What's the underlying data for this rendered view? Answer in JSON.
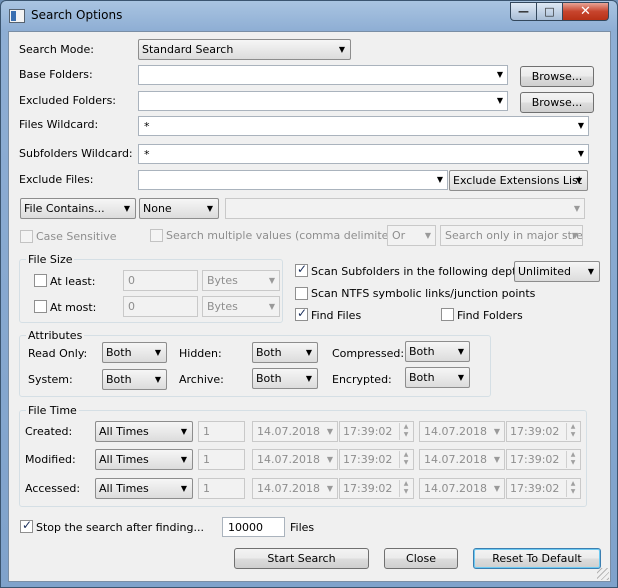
{
  "window": {
    "title": "Search Options",
    "minimize_glyph": "—",
    "maximize_glyph": "□",
    "close_glyph": "✕"
  },
  "search_mode": {
    "label": "Search Mode:",
    "value": "Standard Search"
  },
  "base_folders": {
    "label": "Base Folders:",
    "value": "",
    "browse_label": "Browse..."
  },
  "excluded_folders": {
    "label": "Excluded Folders:",
    "value": "",
    "browse_label": "Browse..."
  },
  "files_wildcard": {
    "label": "Files Wildcard:",
    "value": "*"
  },
  "subfolders_wildcard": {
    "label": "Subfolders Wildcard:",
    "value": "*"
  },
  "exclude_files": {
    "label": "Exclude Files:",
    "value": "",
    "mode": "Exclude Extensions List"
  },
  "content": {
    "mode": "File Contains...",
    "type": "None",
    "value": "",
    "case_sensitive": {
      "label": "Case Sensitive",
      "checked": false,
      "enabled": false
    },
    "multiple_values": {
      "label": "Search multiple values (comma delimited)",
      "checked": false,
      "enabled": false
    },
    "logic": "Or",
    "stream": "Search only in major stre"
  },
  "file_size": {
    "legend": "File Size",
    "at_least": {
      "label": "At least:",
      "checked": false,
      "value": "0",
      "unit": "Bytes"
    },
    "at_most": {
      "label": "At most:",
      "checked": false,
      "value": "0",
      "unit": "Bytes"
    }
  },
  "options": {
    "scan_subfolders": {
      "label": "Scan Subfolders in the following depth:",
      "checked": true,
      "depth": "Unlimited"
    },
    "scan_ntfs": {
      "label": "Scan NTFS symbolic links/junction points",
      "checked": false
    },
    "find_files": {
      "label": "Find Files",
      "checked": true
    },
    "find_folders": {
      "label": "Find Folders",
      "checked": false
    }
  },
  "attributes": {
    "legend": "Attributes",
    "read_only": {
      "label": "Read Only:",
      "value": "Both"
    },
    "hidden": {
      "label": "Hidden:",
      "value": "Both"
    },
    "compressed": {
      "label": "Compressed:",
      "value": "Both"
    },
    "system": {
      "label": "System:",
      "value": "Both"
    },
    "archive": {
      "label": "Archive:",
      "value": "Both"
    },
    "encrypted": {
      "label": "Encrypted:",
      "value": "Both"
    }
  },
  "file_time": {
    "legend": "File Time",
    "rows": [
      {
        "label": "Created:",
        "mode": "All Times",
        "count": "1",
        "date1": "14.07.2018",
        "time1": "17:39:02",
        "date2": "14.07.2018",
        "time2": "17:39:02"
      },
      {
        "label": "Modified:",
        "mode": "All Times",
        "count": "1",
        "date1": "14.07.2018",
        "time1": "17:39:02",
        "date2": "14.07.2018",
        "time2": "17:39:02"
      },
      {
        "label": "Accessed:",
        "mode": "All Times",
        "count": "1",
        "date1": "14.07.2018",
        "time1": "17:39:02",
        "date2": "14.07.2018",
        "time2": "17:39:02"
      }
    ]
  },
  "stop_after": {
    "label": "Stop the search after finding...",
    "checked": true,
    "value": "10000",
    "unit": "Files"
  },
  "buttons": {
    "start": "Start Search",
    "close": "Close",
    "reset": "Reset To Default"
  }
}
